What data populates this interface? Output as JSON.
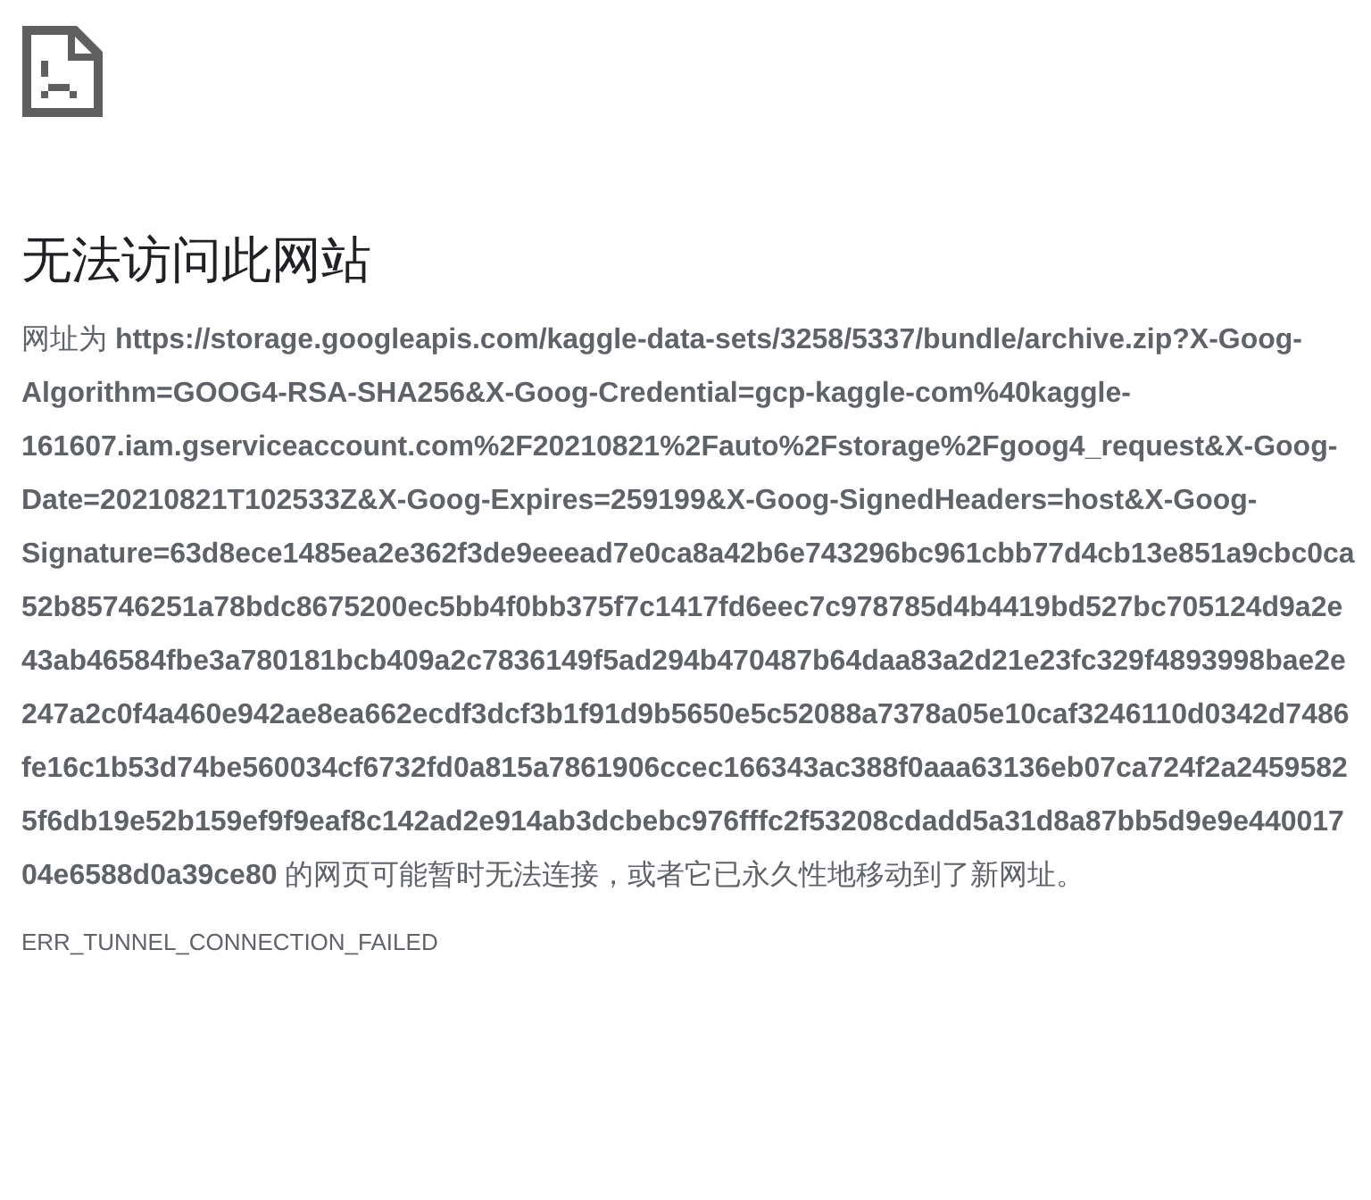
{
  "heading": "无法访问此网站",
  "message": "网址为 **https://storage.googleapis.com/kaggle-data-sets/3258/5337/bundle/archive.zip?X-Goog-Algorithm=GOOG4-RSA-SHA256&X-Goog-Credential=gcp-kaggle-com%40kaggle-161607.iam.gserviceaccount.com%2F20210821%2Fauto%2Fstorage%2Fgoog4_request&X-Goog-Date=20210821T102533Z&X-Goog-Expires=259199&X-Goog-SignedHeaders=host&X-Goog-Signature=63d8ece1485ea2e362f3de9eeead7e0ca8a42b6e743296bc961cbb77d4cb13e851a9cbc0ca52b85746251a78bdc8675200ec5bb4f0bb375f7c1417fd6eec7c978785d4b4419bd527bc705124d9a2e43ab46584fbe3a780181bcb409a2c7836149f5ad294b470487b64daa83a2d21e23fc329f4893998bae2e247a2c0f4a460e942ae8ea662ecdf3dcf3b1f91d9b5650e5c52088a7378a05e10caf3246110d0342d7486fe16c1b53d74be560034cf6732fd0a815a7861906ccec166343ac388f0aaa63136eb07ca724f2a24595825f6db19e52b159ef9f9eaf8c142ad2e914ab3dcbebc976fffc2f53208cdadd5a31d8a87bb5d9e9e44001704e6588d0a39ce80** 的网页可能暂时无法连接，或者它已永久性地移动到了新网址。",
  "error_code": "ERR_TUNNEL_CONNECTION_FAILED"
}
